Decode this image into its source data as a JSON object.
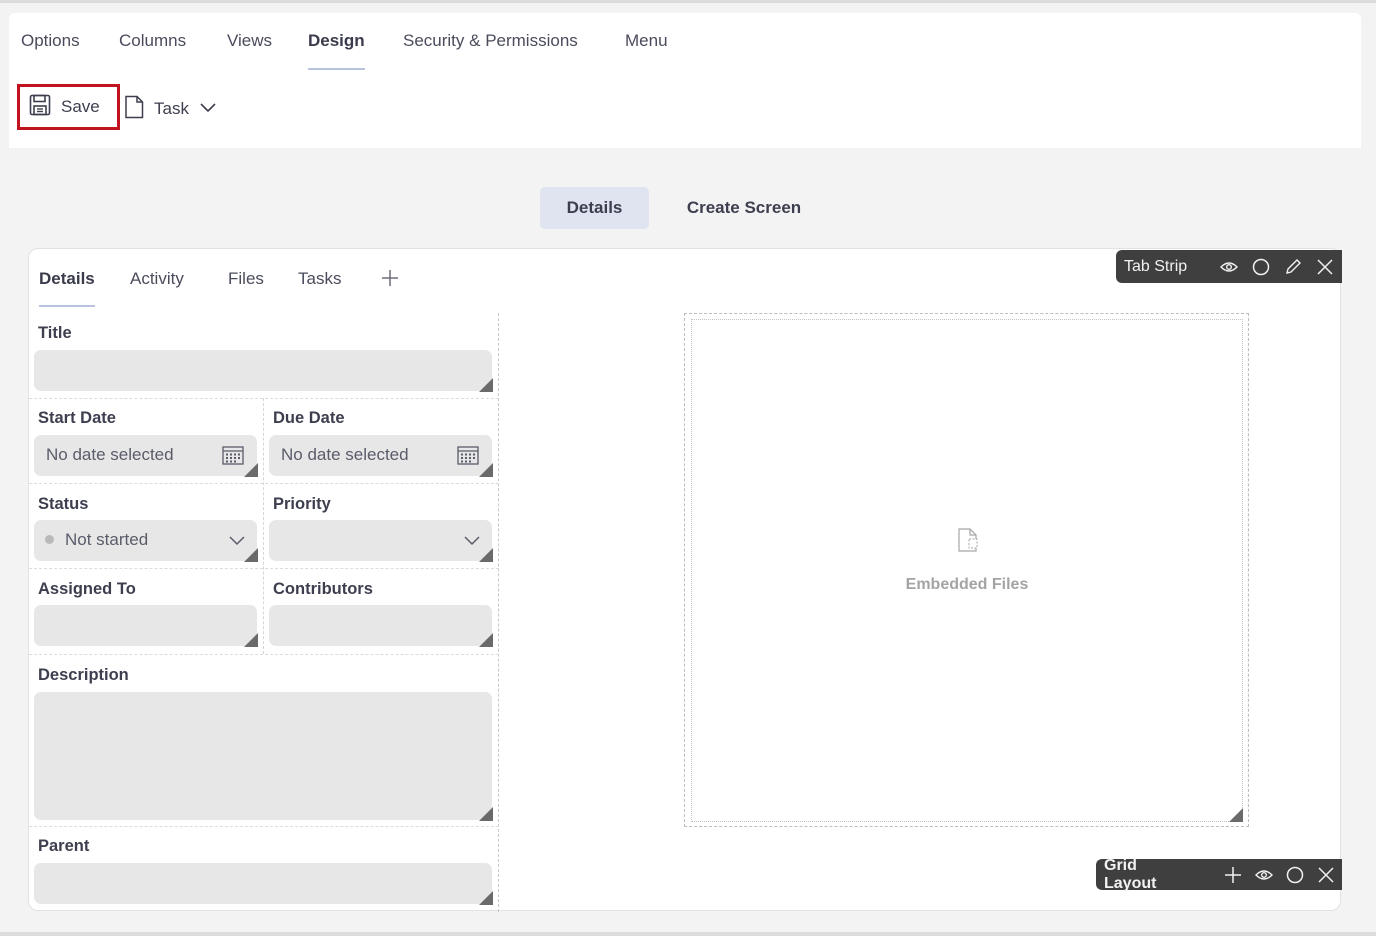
{
  "top_nav": {
    "tabs": [
      "Options",
      "Columns",
      "Views",
      "Design",
      "Security & Permissions",
      "Menu"
    ],
    "active_tab": "Design"
  },
  "toolbar": {
    "save_label": "Save",
    "task_label": "Task"
  },
  "screen_tabs": {
    "selected": "Details",
    "other": "Create Screen"
  },
  "form_tabs": [
    "Details",
    "Activity",
    "Files",
    "Tasks"
  ],
  "tab_strip_toolbar": {
    "label": "Tab Strip"
  },
  "grid_layout_toolbar": {
    "label": "Grid Layout"
  },
  "fields": {
    "title": {
      "label": "Title"
    },
    "start_date": {
      "label": "Start Date",
      "value": "No date selected"
    },
    "due_date": {
      "label": "Due Date",
      "value": "No date selected"
    },
    "status": {
      "label": "Status",
      "value": "Not started"
    },
    "priority": {
      "label": "Priority"
    },
    "assigned_to": {
      "label": "Assigned To"
    },
    "contributors": {
      "label": "Contributors"
    },
    "description": {
      "label": "Description"
    },
    "parent": {
      "label": "Parent"
    }
  },
  "embedded_files": {
    "label": "Embedded Files"
  },
  "colors": {
    "save_highlight": "#c1121f",
    "selected_screen_tab_bg": "#dfe4f0",
    "toolbar_bg": "#3f3f3f",
    "field_bg": "#e7e7e7"
  }
}
